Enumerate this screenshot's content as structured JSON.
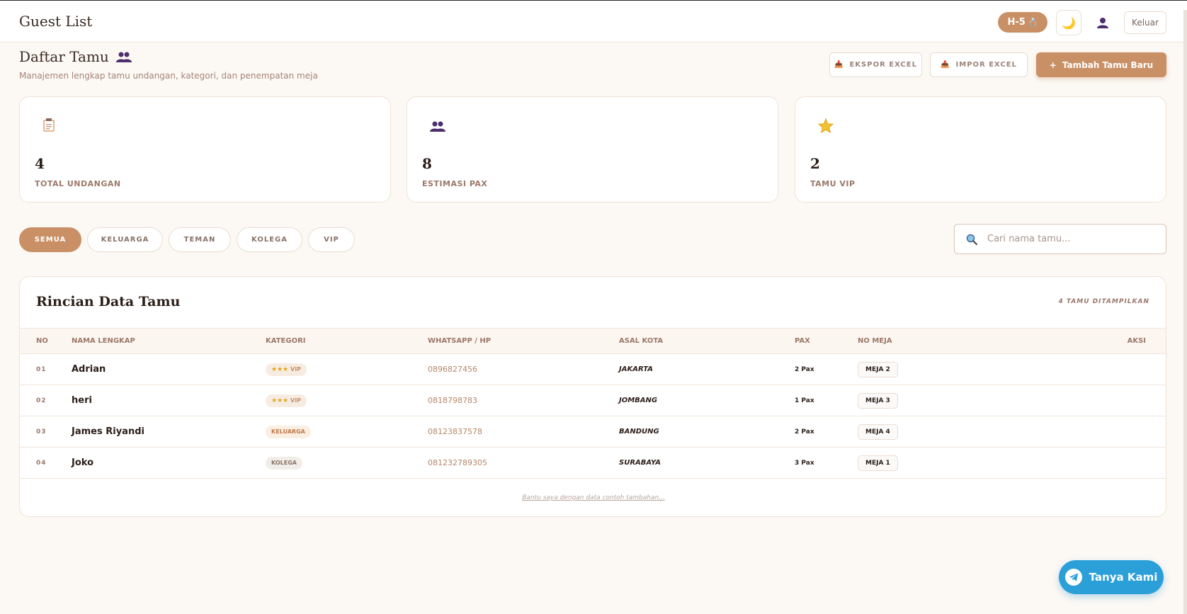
{
  "header": {
    "app_title": "Guest List",
    "countdown": "H-5",
    "logout_label": "Keluar"
  },
  "page": {
    "title": "Daftar Tamu",
    "subtitle": "Manajemen lengkap tamu undangan, kategori, dan penempatan meja"
  },
  "actions": {
    "export_label": "EKSPOR EXCEL",
    "import_label": "IMPOR EXCEL",
    "add_label": "Tambah Tamu Baru",
    "add_prefix": "+"
  },
  "stats": [
    {
      "value": "4",
      "label": "TOTAL UNDANGAN",
      "icon": "clipboard-icon"
    },
    {
      "value": "8",
      "label": "ESTIMASI PAX",
      "icon": "people-icon"
    },
    {
      "value": "2",
      "label": "TAMU VIP",
      "icon": "star-icon"
    }
  ],
  "filters": [
    {
      "label": "SEMUA",
      "active": true
    },
    {
      "label": "KELUARGA",
      "active": false
    },
    {
      "label": "TEMAN",
      "active": false
    },
    {
      "label": "KOLEGA",
      "active": false
    },
    {
      "label": "VIP",
      "active": false
    }
  ],
  "search": {
    "placeholder": "Cari nama tamu..."
  },
  "table": {
    "title": "Rincian Data Tamu",
    "count_label": "4 TAMU DITAMPILKAN",
    "columns": [
      "NO",
      "NAMA LENGKAP",
      "KATEGORI",
      "WHATSAPP / HP",
      "ASAL KOTA",
      "PAX",
      "NO MEJA",
      "AKSI"
    ],
    "rows": [
      {
        "no": "01",
        "name": "Adrian",
        "category": "VIP",
        "stars": "★★★",
        "phone": "0896827456",
        "city": "JAKARTA",
        "pax": "2 Pax",
        "table": "MEJA 2"
      },
      {
        "no": "02",
        "name": "heri",
        "category": "VIP",
        "stars": "★★★",
        "phone": "0818798783",
        "city": "JOMBANG",
        "pax": "1 Pax",
        "table": "MEJA 3"
      },
      {
        "no": "03",
        "name": "James Riyandi",
        "category": "KELUARGA",
        "stars": "",
        "phone": "08123837578",
        "city": "BANDUNG",
        "pax": "2 Pax",
        "table": "MEJA 4"
      },
      {
        "no": "04",
        "name": "Joko",
        "category": "KOLEGA",
        "stars": "",
        "phone": "081232789305",
        "city": "SURABAYA",
        "pax": "3 Pax",
        "table": "MEJA 1"
      }
    ],
    "help_link": "Bantu saya dengan data contoh tambahan..."
  },
  "chat": {
    "label": "Tanya Kami"
  },
  "colors": {
    "accent": "#c99066",
    "background": "#fcf8f4",
    "telegram": "#2b9fd8"
  }
}
